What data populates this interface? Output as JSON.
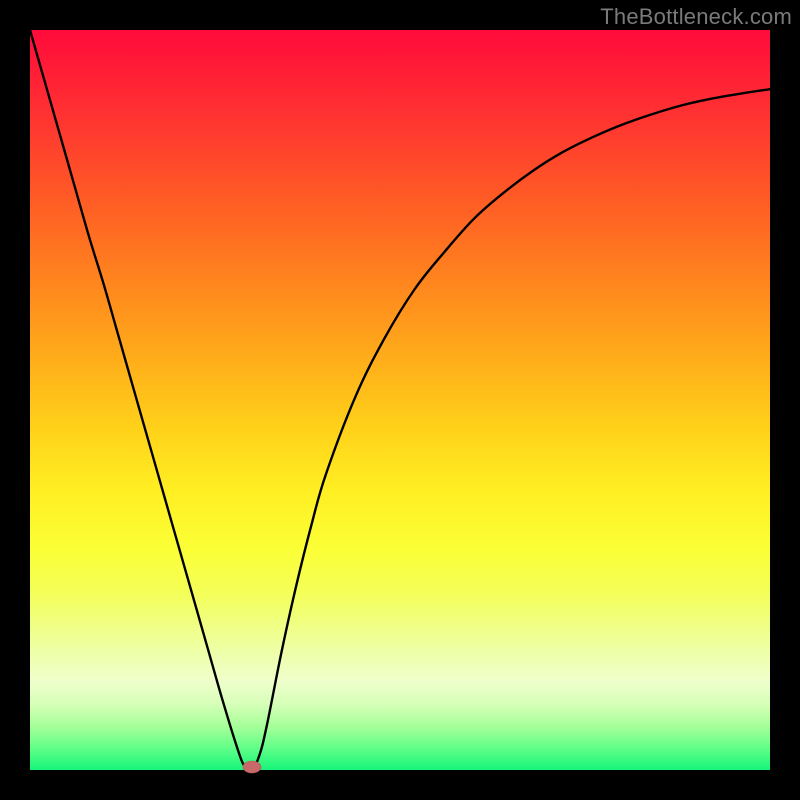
{
  "watermark": "TheBottleneck.com",
  "colors": {
    "frame": "#000000",
    "curve": "#000000",
    "marker": "#c96a6a"
  },
  "chart_data": {
    "type": "line",
    "title": "",
    "xlabel": "",
    "ylabel": "",
    "xlim": [
      0,
      100
    ],
    "ylim": [
      0,
      100
    ],
    "grid": false,
    "legend": false,
    "x": [
      0,
      2,
      4,
      6,
      8,
      10,
      12,
      14,
      16,
      18,
      20,
      22,
      24,
      26,
      28,
      29,
      30,
      31,
      32,
      34,
      36,
      38,
      40,
      44,
      48,
      52,
      56,
      60,
      64,
      68,
      72,
      76,
      80,
      84,
      88,
      92,
      96,
      100
    ],
    "values": [
      100,
      93,
      86,
      79,
      72,
      65.5,
      58.5,
      51.5,
      44.5,
      37.5,
      30.5,
      23.5,
      16.5,
      9.5,
      3,
      0.5,
      0,
      2,
      6,
      16,
      25,
      33,
      40,
      50.5,
      58.5,
      65,
      70,
      74.5,
      78,
      81,
      83.5,
      85.5,
      87.2,
      88.6,
      89.8,
      90.7,
      91.4,
      92
    ],
    "marker": {
      "x": 30,
      "y": 0,
      "shape": "ellipse"
    },
    "gradient_stops": [
      {
        "pos": 0,
        "color": "#ff0b3a"
      },
      {
        "pos": 50,
        "color": "#ffd21a"
      },
      {
        "pos": 80,
        "color": "#f0ff80"
      },
      {
        "pos": 100,
        "color": "#16f57a"
      }
    ]
  }
}
